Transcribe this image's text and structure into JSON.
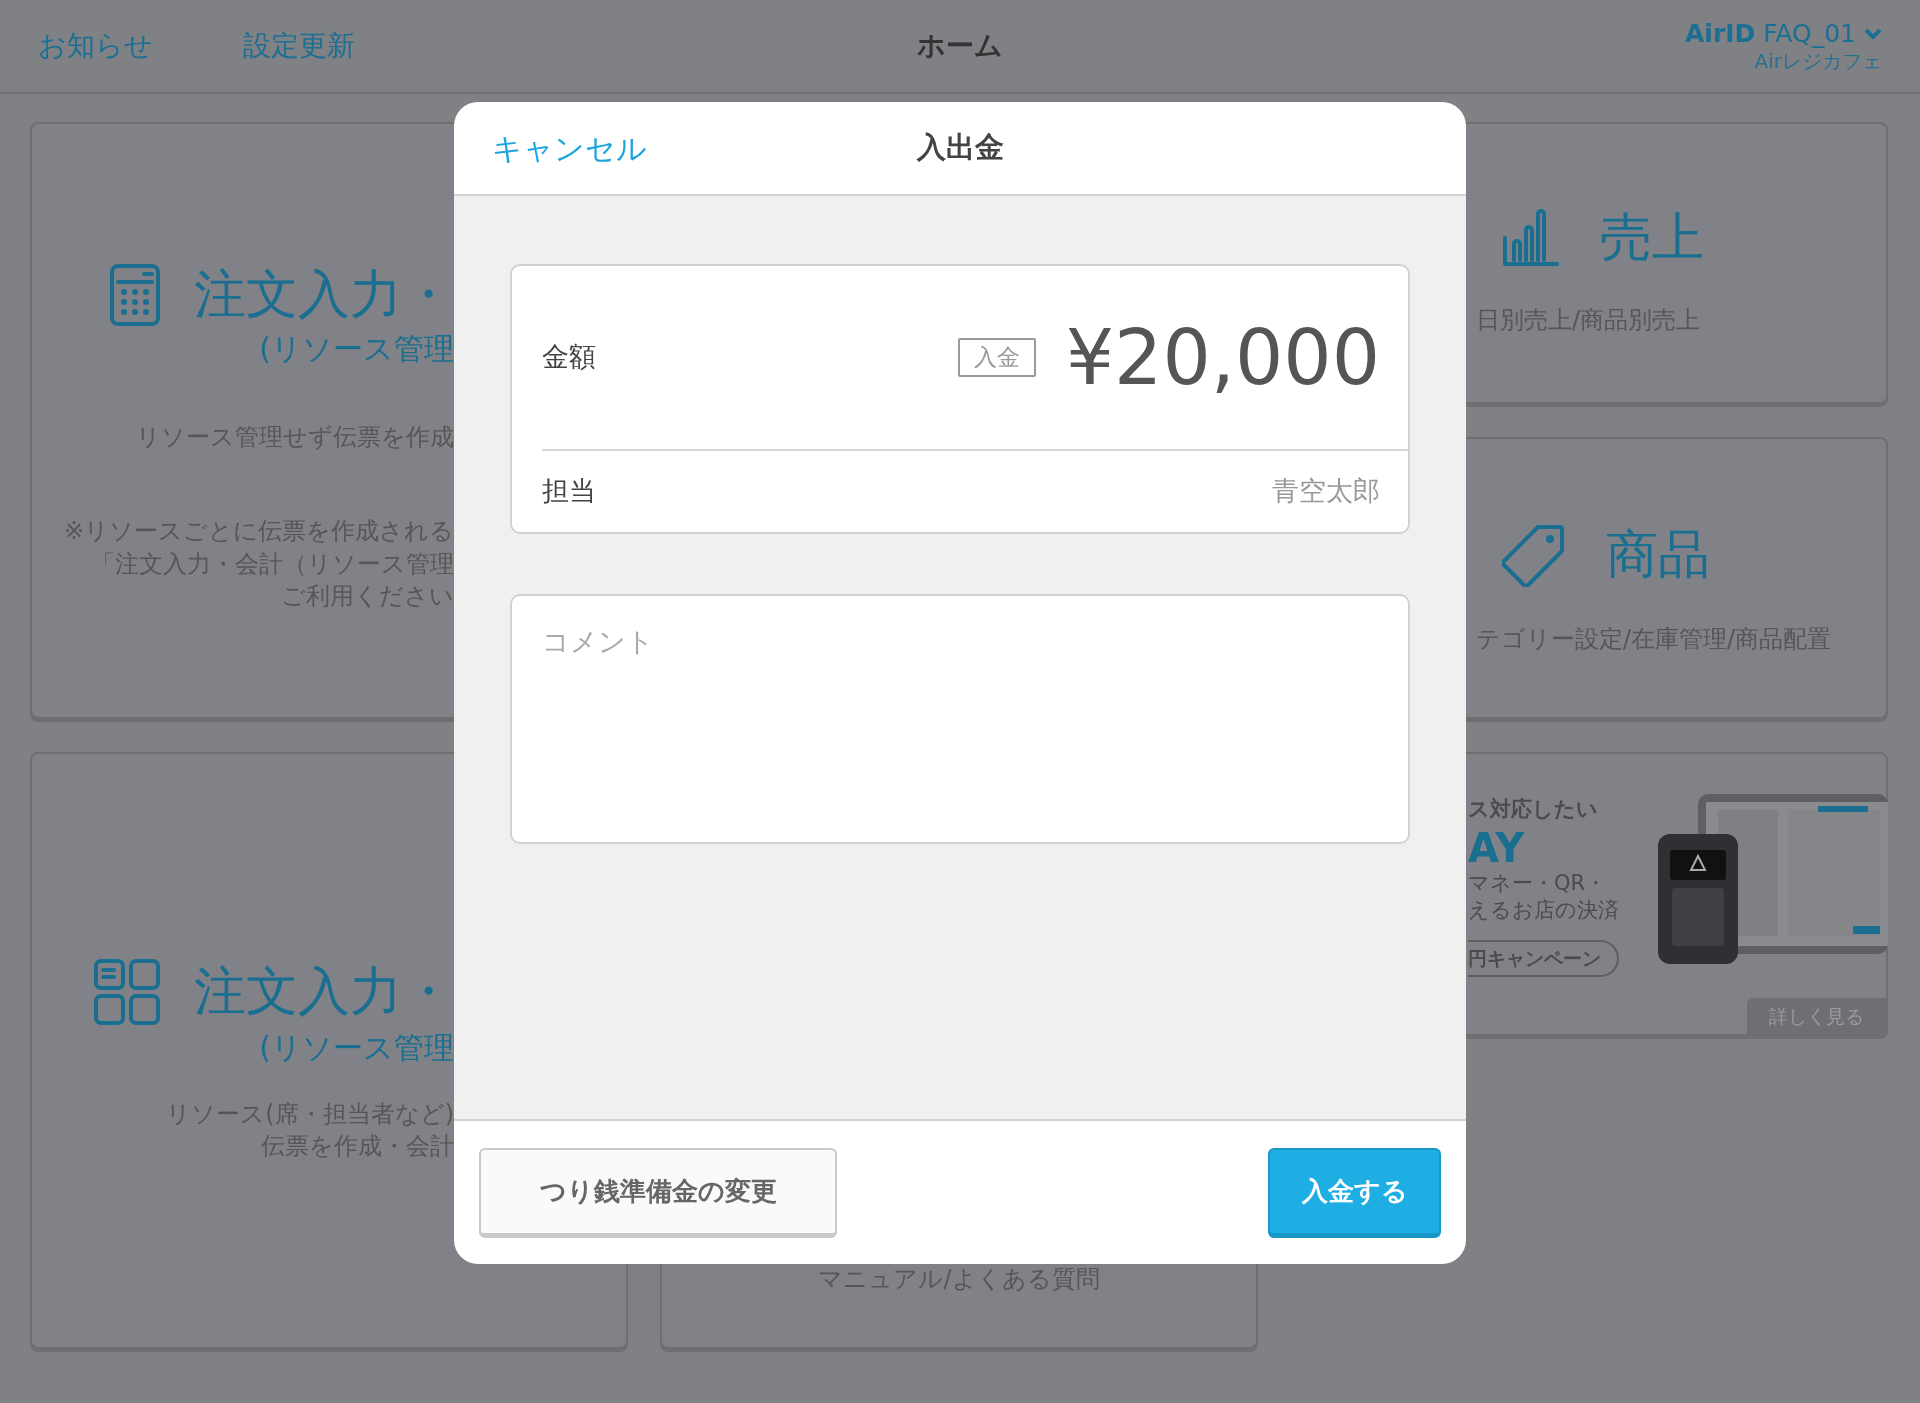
{
  "header": {
    "links": [
      "お知らせ",
      "設定更新"
    ],
    "title": "ホーム",
    "account": {
      "id_label": "AirID",
      "id": "FAQ_01",
      "store": "Airレジカフェ"
    }
  },
  "cards": [
    {
      "kind": "menu",
      "title": "注文入力・",
      "subtitle": "(リソース管理",
      "lines": [
        "リソース管理せず伝票を作成",
        "※リソースごとに伝票を作成される",
        "「注文入力・会計（リソース管理",
        "ご利用ください"
      ]
    },
    {
      "kind": "menu",
      "title": "売上",
      "lines": [
        "日別売上/商品別売上"
      ]
    },
    {
      "kind": "menu",
      "title": "商品",
      "lines": [
        "テゴリー設定/在庫管理/商品配置"
      ]
    },
    {
      "kind": "menu",
      "title": "注文入力・",
      "subtitle": "(リソース管理",
      "lines": [
        "リソース(席・担当者など)",
        "伝票を作成・会計"
      ]
    },
    {
      "kind": "menu",
      "lines": [
        "マニュアル/よくある質問"
      ]
    },
    {
      "kind": "promo",
      "heading": "ス対応したい",
      "logo": "AY",
      "lines": [
        "マネー・QR・",
        "えるお店の決済"
      ],
      "campaign": "円キャンペーン",
      "more": "詳しく見る"
    }
  ],
  "dialog": {
    "cancel": "キャンセル",
    "title": "入出金",
    "rows": [
      {
        "label": "金額",
        "tag": "入金",
        "value": "¥20,000"
      },
      {
        "label": "担当",
        "value": "青空太郎"
      }
    ],
    "comment": {
      "placeholder": "コメント"
    },
    "buttons": [
      {
        "label": "つり銭準備金の変更",
        "primary": false
      },
      {
        "label": "入金する",
        "primary": true
      }
    ]
  }
}
